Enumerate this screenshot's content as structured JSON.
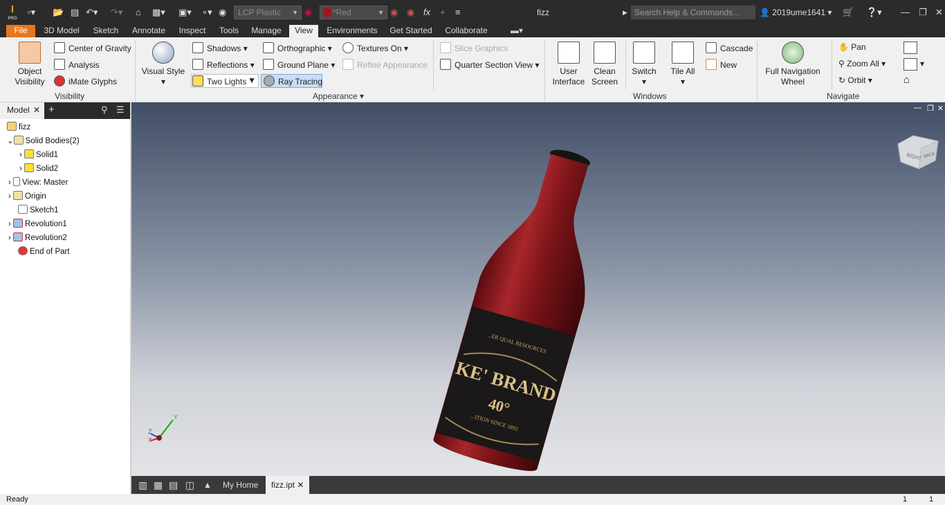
{
  "app": {
    "logo": "I",
    "logo_sub": "PRO",
    "window_title": "fizz",
    "search_placeholder": "Search Help & Commands...",
    "user": "2019ume1641"
  },
  "quick_access": {
    "material": "LCP Plastic",
    "appearance": "*Red",
    "fx": "fx"
  },
  "tabs": [
    "File",
    "3D Model",
    "Sketch",
    "Annotate",
    "Inspect",
    "Tools",
    "Manage",
    "View",
    "Environments",
    "Get Started",
    "Collaborate"
  ],
  "active_tab": "View",
  "ribbon": {
    "visibility": {
      "object_visibility_1": "Object",
      "object_visibility_2": "Visibility",
      "center_of_gravity": "Center of Gravity",
      "analysis": "Analysis",
      "imate_glyphs": "iMate Glyphs",
      "label": "Visibility"
    },
    "appearance": {
      "visual_style": "Visual Style",
      "shadows": "Shadows",
      "reflections": "Reflections",
      "two_lights": "Two Lights",
      "orthographic": "Orthographic",
      "ground_plane": "Ground Plane",
      "ray_tracing": "Ray Tracing",
      "textures_on": "Textures On",
      "refine_appearance": "Refine Appearance",
      "slice_graphics": "Slice Graphics",
      "quarter_section_view": "Quarter Section View",
      "label": "Appearance"
    },
    "windows": {
      "user_interface_1": "User",
      "user_interface_2": "Interface",
      "clean_screen_1": "Clean",
      "clean_screen_2": "Screen",
      "switch": "Switch",
      "tile_all": "Tile All",
      "cascade": "Cascade",
      "new": "New",
      "label": "Windows"
    },
    "navigate": {
      "full_nav_1": "Full Navigation",
      "full_nav_2": "Wheel",
      "pan": "Pan",
      "zoom_all": "Zoom All",
      "orbit": "Orbit",
      "label": "Navigate"
    }
  },
  "browser": {
    "tab": "Model",
    "tree": [
      {
        "label": "fizz"
      },
      {
        "label": "Solid Bodies(2)"
      },
      {
        "label": "Solid1"
      },
      {
        "label": "Solid2"
      },
      {
        "label": "View: Master"
      },
      {
        "label": "Origin"
      },
      {
        "label": "Sketch1"
      },
      {
        "label": "Revolution1"
      },
      {
        "label": "Revolution2"
      },
      {
        "label": "End of Part"
      }
    ]
  },
  "viewport": {
    "label_line1": "...ER QUAL RESOURCES",
    "label_brand": "KE' BRAND",
    "label_degree": "40°",
    "label_since": "...ITION SINCE 1892",
    "viewcube_right": "RIGHT",
    "viewcube_back": "BACK",
    "triad_y": "Y",
    "triad_z": "Z",
    "triad_x": "X"
  },
  "doc_tabs": {
    "home": "My Home",
    "file": "fizz.ipt"
  },
  "status": {
    "text": "Ready",
    "num1": "1",
    "num2": "1"
  },
  "colors": {
    "accent": "#e8761c",
    "bottle": "#8a1418",
    "title_bar": "#2b2b2b"
  }
}
